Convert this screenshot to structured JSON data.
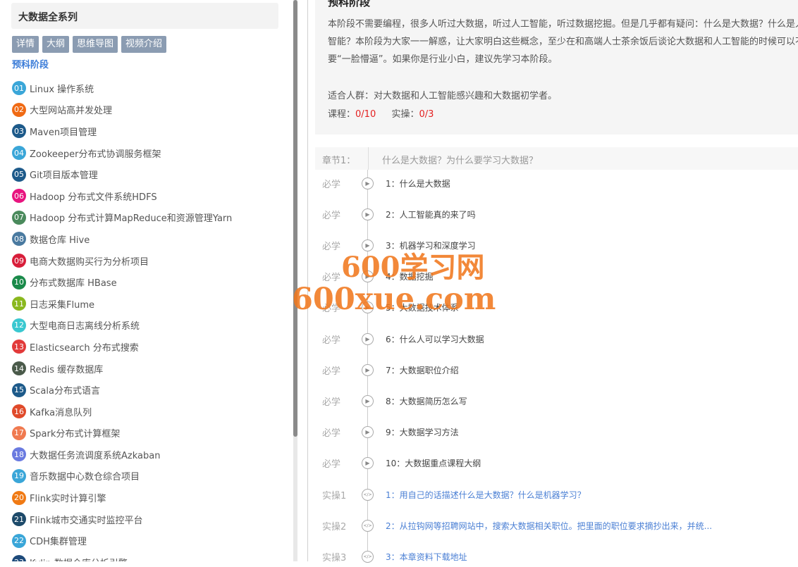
{
  "sidebar": {
    "title": "大数据全系列",
    "tabs": [
      "详情",
      "大纲",
      "思维导图",
      "视频介绍"
    ],
    "stage_label": "预科阶段",
    "courses": [
      {
        "num": "01",
        "name": "Linux 操作系统",
        "color": "#3aa6d8"
      },
      {
        "num": "02",
        "name": "大型网站高并发处理",
        "color": "#f06a14"
      },
      {
        "num": "03",
        "name": "Maven项目管理",
        "color": "#1d5a8a"
      },
      {
        "num": "04",
        "name": "Zookeeper分布式协调服务框架",
        "color": "#3aa6d8"
      },
      {
        "num": "05",
        "name": "Git项目版本管理",
        "color": "#1d5a8a"
      },
      {
        "num": "06",
        "name": "Hadoop 分布式文件系统HDFS",
        "color": "#e8147f"
      },
      {
        "num": "07",
        "name": "Hadoop 分布式计算MapReduce和资源管理Yarn",
        "color": "#4a8a5c"
      },
      {
        "num": "08",
        "name": "数据仓库 Hive",
        "color": "#4a7aa0"
      },
      {
        "num": "09",
        "name": "电商大数据购买行为分析项目",
        "color": "#d81e3a"
      },
      {
        "num": "10",
        "name": "分布式数据库 HBase",
        "color": "#1a8a4a"
      },
      {
        "num": "11",
        "name": "日志采集Flume",
        "color": "#8ab81e"
      },
      {
        "num": "12",
        "name": "大型电商日志离线分析系统",
        "color": "#3ac8d0"
      },
      {
        "num": "13",
        "name": "Elasticsearch 分布式搜索",
        "color": "#e23a3a"
      },
      {
        "num": "14",
        "name": "Redis 缓存数据库",
        "color": "#4a5a4a"
      },
      {
        "num": "15",
        "name": "Scala分布式语言",
        "color": "#1d5a8a"
      },
      {
        "num": "16",
        "name": "Kafka消息队列",
        "color": "#e04a2a"
      },
      {
        "num": "17",
        "name": "Spark分布式计算框架",
        "color": "#f07a50"
      },
      {
        "num": "18",
        "name": "大数据任务流调度系统Azkaban",
        "color": "#6a7ae0"
      },
      {
        "num": "19",
        "name": "音乐数据中心数仓综合项目",
        "color": "#3aa6d8"
      },
      {
        "num": "20",
        "name": "Flink实时计算引擎",
        "color": "#f07a14"
      },
      {
        "num": "21",
        "name": "Flink城市交通实时监控平台",
        "color": "#1d4a6a"
      },
      {
        "num": "22",
        "name": "CDH集群管理",
        "color": "#3aa6d8"
      },
      {
        "num": "23",
        "name": "Kylin 数据仓库分析引擎",
        "color": "#1d4a7a"
      }
    ]
  },
  "intro": {
    "title": "预科阶段",
    "desc": "本阶段不需要编程，很多人听过大数据，听过人工智能，听过数据挖掘。但是几乎都有疑问：什么是大数据？什么是人工智能？本阶段为大家一一解惑，让大家明白这些概念，至少在和高端人士茶余饭后谈论大数据和人工智能的时候可以不需要“一脸懵逼”。如果你是行业小白，建议先学习本阶段。",
    "audience": "适合人群：对大数据和人工智能感兴趣和大数据初学者。",
    "course_label": "课程：",
    "course_value": "0/10",
    "practice_label": "实操：",
    "practice_value": "0/3"
  },
  "chapter": {
    "label": "章节1：",
    "title": "什么是大数据？为什么要学习大数据？"
  },
  "lessons": [
    {
      "type": "必学",
      "title": "1：什么是大数据",
      "icon": "play-icon"
    },
    {
      "type": "必学",
      "title": "2：人工智能真的来了吗",
      "icon": "play-icon"
    },
    {
      "type": "必学",
      "title": "3：机器学习和深度学习",
      "icon": "play-icon"
    },
    {
      "type": "必学",
      "title": "4：数据挖掘",
      "icon": "play-icon"
    },
    {
      "type": "必学",
      "title": "5：大数据技术体系",
      "icon": "play-icon"
    },
    {
      "type": "必学",
      "title": "6：什么人可以学习大数据",
      "icon": "play-icon"
    },
    {
      "type": "必学",
      "title": "7：大数据职位介绍",
      "icon": "play-icon"
    },
    {
      "type": "必学",
      "title": "8：大数据简历怎么写",
      "icon": "play-icon"
    },
    {
      "type": "必学",
      "title": "9：大数据学习方法",
      "icon": "play-icon"
    },
    {
      "type": "必学",
      "title": "10：大数据重点课程大纲",
      "icon": "play-icon"
    },
    {
      "type": "实操1",
      "title": "1：用自己的话描述什么是大数据？什么是机器学习？",
      "icon": "code-icon"
    },
    {
      "type": "实操2",
      "title": "2：从拉钩网等招聘网站中，搜索大数据相关职位。把里面的职位要求摘抄出来，并统...",
      "icon": "code-icon"
    },
    {
      "type": "实操3",
      "title": "3：本章资料下载地址",
      "icon": "code-icon"
    }
  ],
  "watermark": {
    "line1": "600学习网",
    "line2": "600xue.com"
  }
}
